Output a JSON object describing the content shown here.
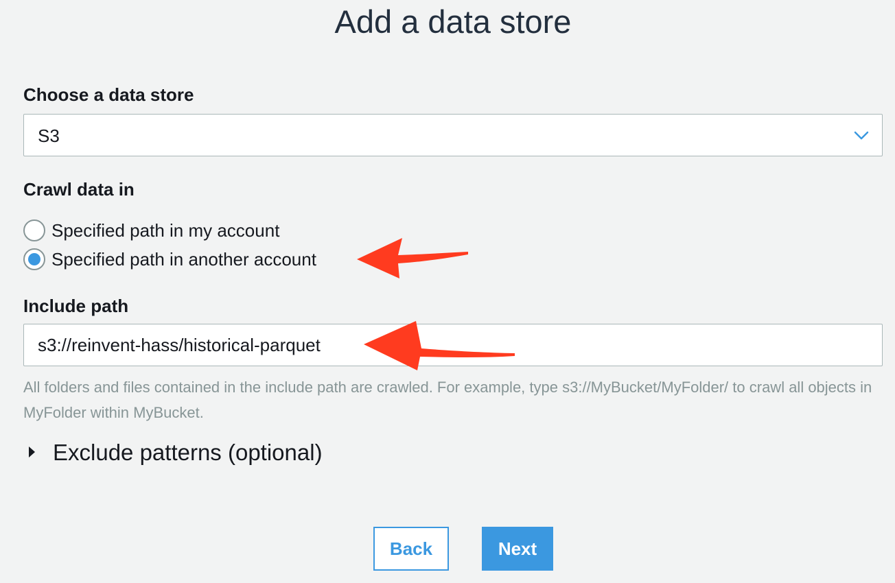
{
  "page": {
    "title": "Add a data store"
  },
  "data_store": {
    "label": "Choose a data store",
    "selected_value": "S3"
  },
  "crawl": {
    "label": "Crawl data in",
    "options": [
      {
        "label": "Specified path in my account",
        "checked": false
      },
      {
        "label": "Specified path in another account",
        "checked": true
      }
    ]
  },
  "include_path": {
    "label": "Include path",
    "value": "s3://reinvent-hass/historical-parquet",
    "help_text": "All folders and files contained in the include path are crawled. For example, type s3://MyBucket/MyFolder/ to crawl all objects in MyFolder within MyBucket."
  },
  "exclude": {
    "label": "Exclude patterns (optional)",
    "expanded": false
  },
  "buttons": {
    "back": "Back",
    "next": "Next"
  },
  "colors": {
    "accent": "#3b98e0",
    "annotation_arrow": "#ff3b1f"
  },
  "icons": {
    "select": "chevron-down-icon",
    "expander": "caret-right-icon",
    "annotation": "red-arrow-icon"
  }
}
